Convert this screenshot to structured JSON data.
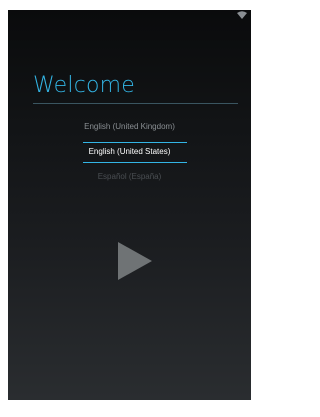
{
  "screen": {
    "title": "Welcome",
    "accent_color": "#33b5e5"
  },
  "language_picker": {
    "items": [
      {
        "label": "English (United Kingdom)",
        "state": "above"
      },
      {
        "label": "English (United States)",
        "state": "selected"
      },
      {
        "label": "Español (España)",
        "state": "below"
      }
    ]
  },
  "start": {
    "icon": "play-icon"
  },
  "status_bar": {
    "icons": [
      "wifi-icon"
    ]
  }
}
